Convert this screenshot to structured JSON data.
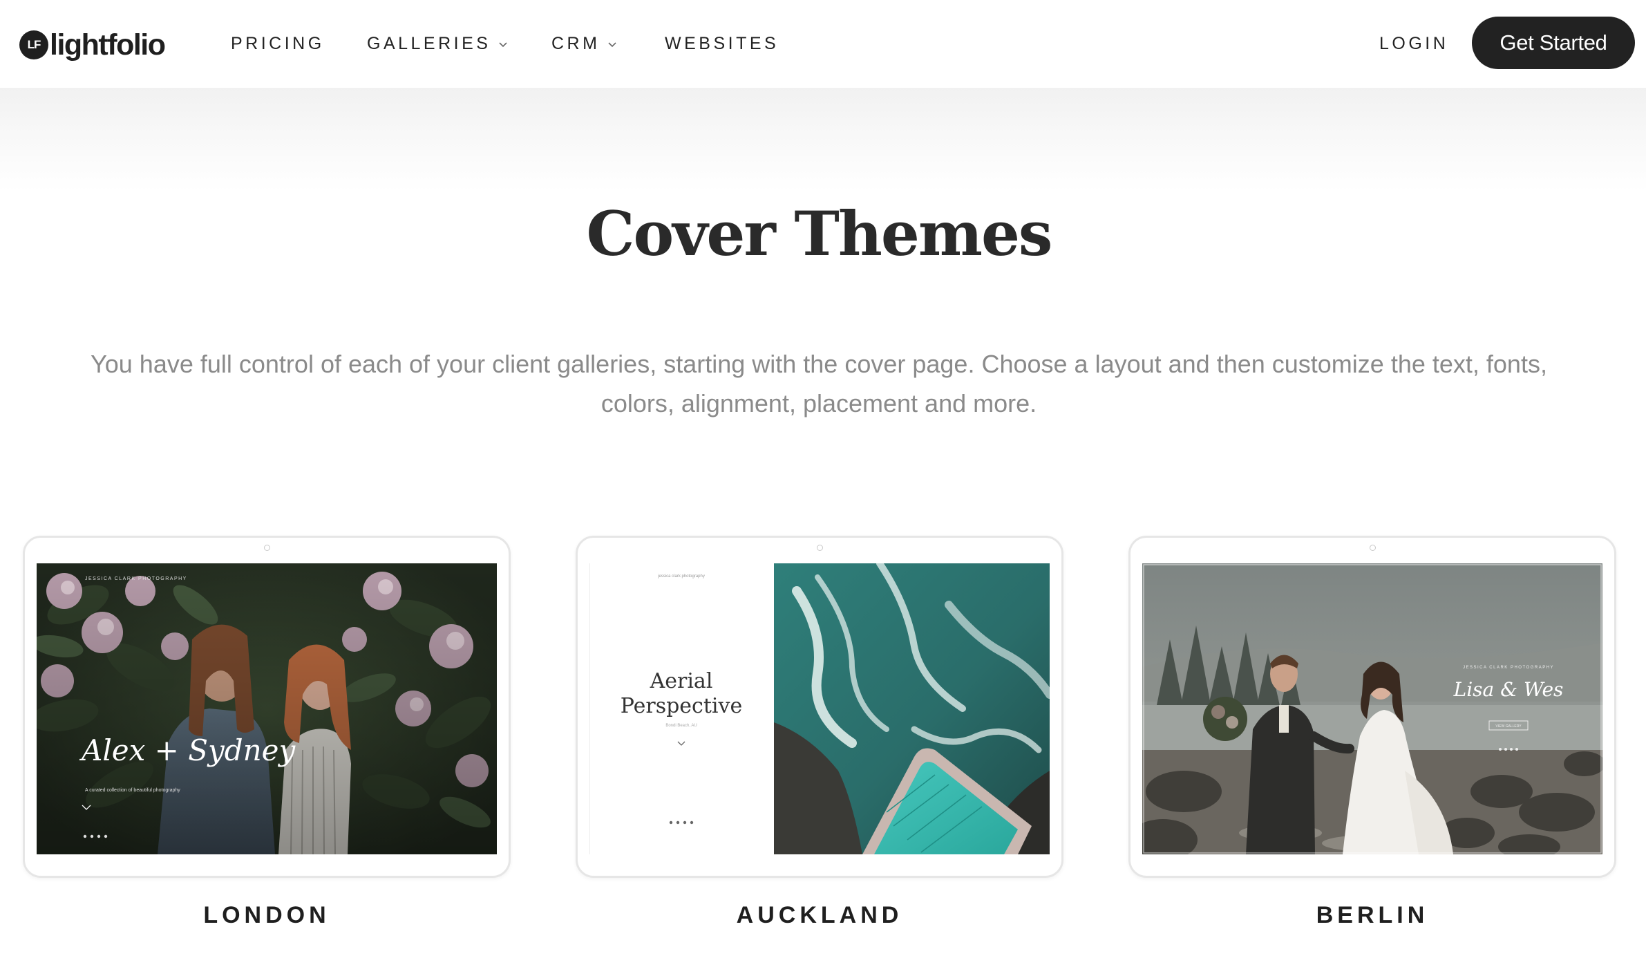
{
  "header": {
    "logo_mark": "LF",
    "logo_text": "lightfolio",
    "nav": [
      {
        "label": "PRICING",
        "dropdown": false
      },
      {
        "label": "GALLERIES",
        "dropdown": true
      },
      {
        "label": "CRM",
        "dropdown": true
      },
      {
        "label": "WEBSITES",
        "dropdown": false
      }
    ],
    "login_label": "LOGIN",
    "cta_label": "Get Started"
  },
  "hero": {
    "title": "Cover Themes",
    "description": "You have full control of each of your client galleries, starting with the cover page. Choose a layout and then customize the text, fonts, colors, alignment, placement and more."
  },
  "themes": [
    {
      "name": "LONDON",
      "preview": {
        "studio": "JESSICA CLARK PHOTOGRAPHY",
        "names": "Alex + Sydney",
        "tagline": "A curated collection of beautiful photography"
      }
    },
    {
      "name": "AUCKLAND",
      "preview": {
        "studio": "jessica clark photography",
        "title_line1": "Aerial",
        "title_line2": "Perspective",
        "subtitle": "Bondi Beach, AU"
      }
    },
    {
      "name": "BERLIN",
      "preview": {
        "studio": "JESSICA CLARK PHOTOGRAPHY",
        "names": "Lisa & Wes",
        "button": "VIEW GALLERY"
      }
    }
  ],
  "colors": {
    "text_dark": "#2a2a2a",
    "text_muted": "#8a8a8a",
    "button_bg": "#222222",
    "card_border": "#e6e6e6"
  }
}
